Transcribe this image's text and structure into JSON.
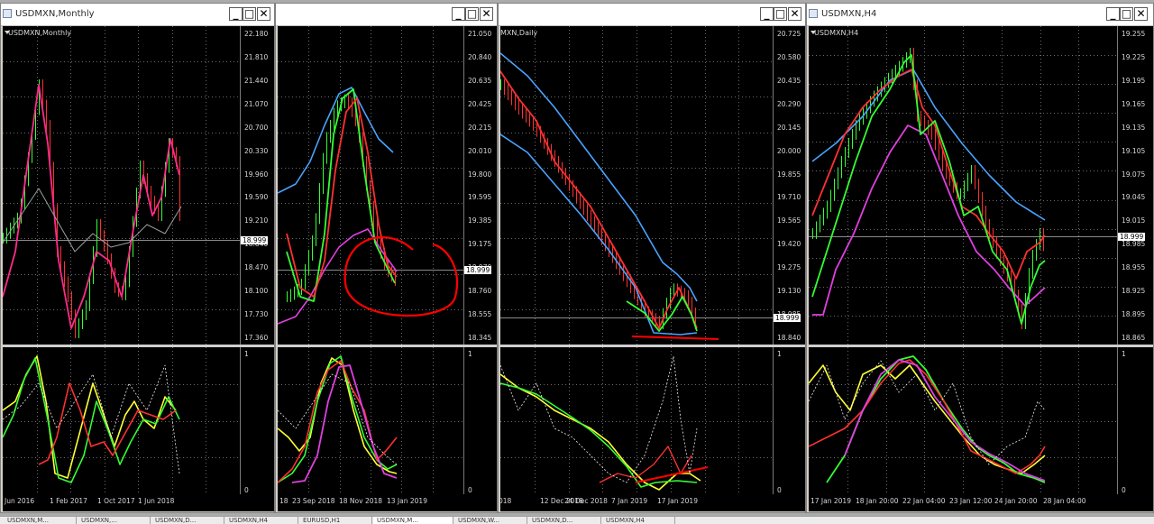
{
  "windows": [
    {
      "title": "USDMXN,Monthly",
      "chart_label": "USDMXN,Monthly",
      "price_ticks": [
        "22.180",
        "21.810",
        "21.440",
        "21.070",
        "20.700",
        "20.330",
        "19.960",
        "19.590",
        "19.210",
        "18.840",
        "18.470",
        "18.100",
        "17.730",
        "17.360"
      ],
      "current_price": "18.999",
      "osc_ticks": [
        "1",
        "0"
      ],
      "date_labels": [
        "Jun 2016",
        "1 Feb 2017",
        "1 Oct 2017",
        "1 Jun 2018"
      ],
      "controls": {
        "minimize": "_",
        "maximize": "□",
        "close": "✕"
      }
    },
    {
      "title": "",
      "chart_label": "",
      "price_ticks": [
        "21.050",
        "20.840",
        "20.635",
        "20.425",
        "20.215",
        "20.010",
        "19.800",
        "19.595",
        "19.385",
        "19.175",
        "18.970",
        "18.760",
        "18.555",
        "18.345"
      ],
      "current_price": "18.999",
      "osc_ticks": [
        "1",
        "0"
      ],
      "date_labels": [
        "18",
        "23 Sep 2018",
        "18 Nov 2018",
        "13 Jan 2019"
      ],
      "controls": {
        "minimize": "_",
        "maximize": "□",
        "close": "✕"
      }
    },
    {
      "title": "",
      "chart_label": "MXN,Daily",
      "price_ticks": [
        "20.725",
        "20.580",
        "20.435",
        "20.290",
        "20.145",
        "20.000",
        "19.855",
        "19.710",
        "19.565",
        "19.420",
        "19.275",
        "19.130",
        "18.985",
        "18.840"
      ],
      "current_price": "18.999",
      "osc_ticks": [
        "1",
        "0"
      ],
      "date_labels": [
        "018",
        "12 Dec 2018",
        "24 Dec 2018",
        "7 Jan 2019",
        "17 Jan 2019"
      ],
      "controls": {
        "minimize": "_",
        "maximize": "□",
        "close": "✕"
      }
    },
    {
      "title": "USDMXN,H4",
      "chart_label": "USDMXN,H4",
      "price_ticks": [
        "19.255",
        "19.225",
        "19.195",
        "19.165",
        "19.135",
        "19.105",
        "19.075",
        "19.045",
        "19.015",
        "18.985",
        "18.955",
        "18.925",
        "18.895",
        "18.865"
      ],
      "current_price": "18.999",
      "osc_ticks": [
        "1",
        "0"
      ],
      "date_labels": [
        "17 Jan 2019",
        "18 Jan 20:00",
        "22 Jan 04:00",
        "23 Jan 12:00",
        "24 Jan 20:00",
        "28 Jan 04:00"
      ],
      "controls": {
        "minimize": "_",
        "maximize": "□",
        "close": "✕"
      }
    }
  ],
  "tabs": [
    "USDMXN,M...",
    "USDMXN,...",
    "USDMXN,D...",
    "USDMXN,H4",
    "EURUSD,H1",
    "USDMXN,M...",
    "USDMXN,W...",
    "USDMXN,D...",
    "USDMXN,H4"
  ],
  "colors": {
    "background": "#000000",
    "grid": "#6b6b6b",
    "bull": "#33ff33",
    "bear": "#ff3030",
    "envelope_upper": "#4aa3ff",
    "envelope_lower": "#e040e0",
    "monthly_line": "#ff2a8c",
    "signal": "#ffff33",
    "annotation": "#ff0000"
  }
}
